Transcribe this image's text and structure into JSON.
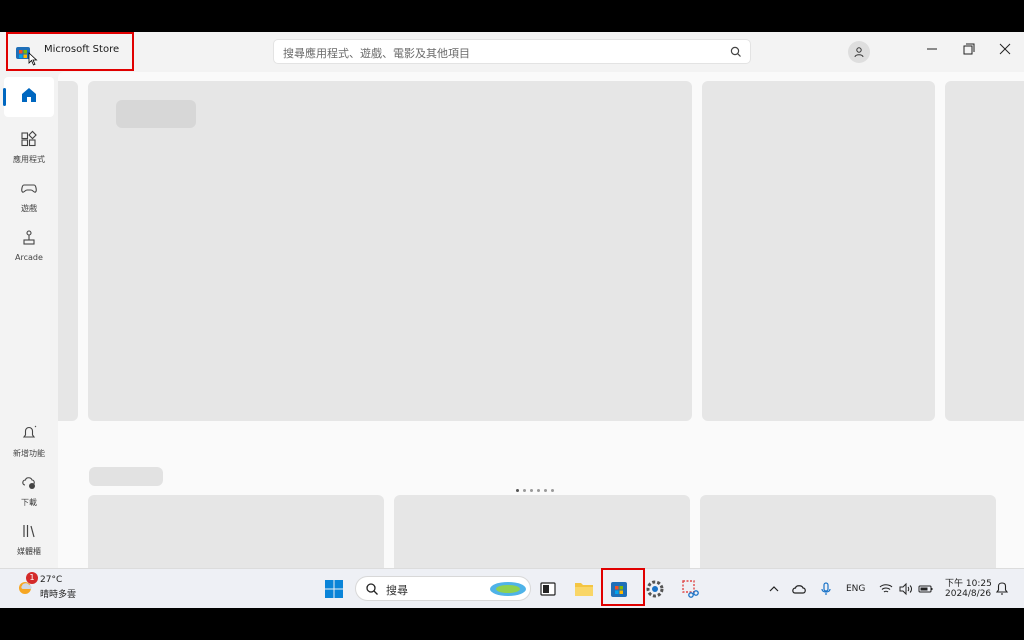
{
  "app": {
    "title": "Microsoft Store"
  },
  "search": {
    "placeholder": "搜尋應用程式、遊戲、電影及其他項目"
  },
  "sidebar": {
    "items": [
      {
        "label": ""
      },
      {
        "label": "應用程式"
      },
      {
        "label": "遊戲"
      },
      {
        "label": "Arcade"
      },
      {
        "label": "新增功能"
      },
      {
        "label": "下載"
      },
      {
        "label": "媒體櫃"
      }
    ]
  },
  "taskbar": {
    "search_label": "搜尋",
    "weather": {
      "temp": "27°C",
      "desc": "晴時多雲",
      "badge": "1"
    },
    "language": "ENG",
    "time": "下午 10:25",
    "date": "2024/8/26"
  },
  "colors": {
    "accent": "#0067c0",
    "highlight": "#e00000"
  }
}
